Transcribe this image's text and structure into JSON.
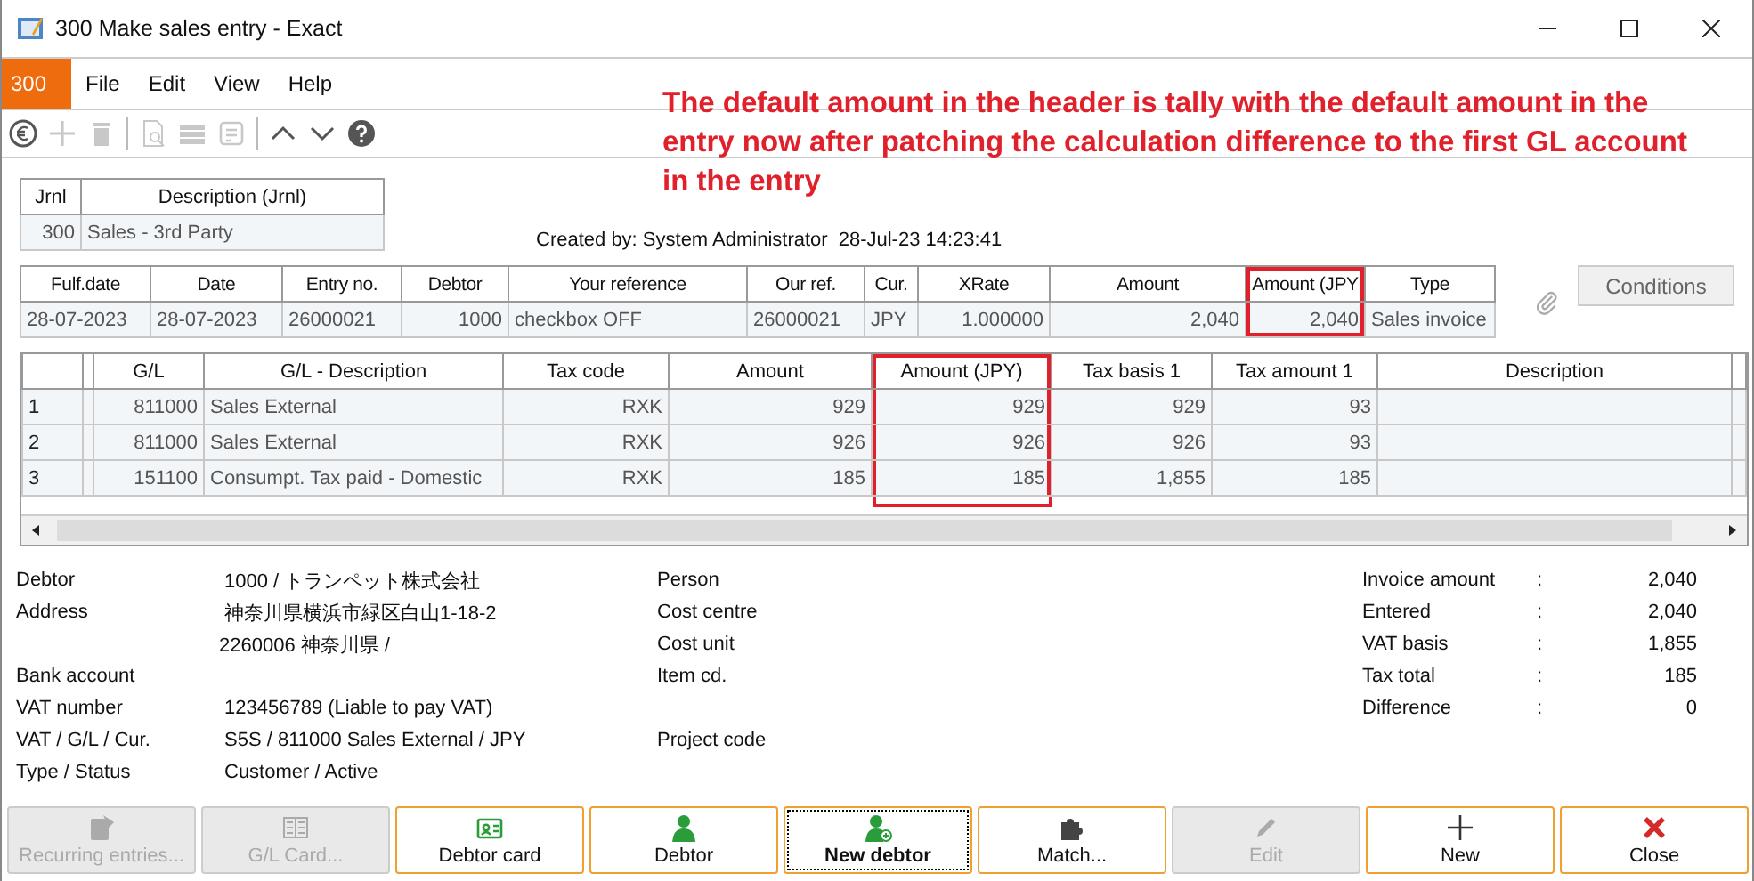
{
  "window": {
    "title": "300 Make sales entry - Exact"
  },
  "menu": {
    "badge": "300",
    "items": [
      "File",
      "Edit",
      "View",
      "Help"
    ]
  },
  "toolbar": [
    {
      "kind": "euro",
      "disabled": false
    },
    {
      "kind": "plus",
      "disabled": true
    },
    {
      "kind": "trash",
      "disabled": true
    },
    {
      "kind": "preview",
      "disabled": true
    },
    {
      "kind": "list",
      "disabled": true
    },
    {
      "kind": "note",
      "disabled": true
    },
    {
      "kind": "up",
      "disabled": false
    },
    {
      "kind": "down",
      "disabled": false
    },
    {
      "kind": "help",
      "disabled": false
    }
  ],
  "annotation": "The default amount in the header is tally with the default amount in the entry now after patching the calculation difference to the first GL account in the entry",
  "journal": {
    "columns": [
      "Jrnl",
      "Description (Jrnl)"
    ],
    "row": [
      "300",
      "Sales - 3rd Party"
    ]
  },
  "created_by": {
    "label": "Created by: System Administrator",
    "timestamp": "28-Jul-23 14:23:41"
  },
  "header": {
    "columns": [
      {
        "label": "Fulf.date",
        "highlighted": false
      },
      {
        "label": "Date",
        "highlighted": false
      },
      {
        "label": "Entry no.",
        "highlighted": false
      },
      {
        "label": "Debtor",
        "highlighted": false
      },
      {
        "label": "Your reference",
        "highlighted": false
      },
      {
        "label": "Our ref.",
        "highlighted": false
      },
      {
        "label": "Cur.",
        "highlighted": false
      },
      {
        "label": "XRate",
        "highlighted": false
      },
      {
        "label": "Amount",
        "highlighted": false
      },
      {
        "label": "Amount (JPY",
        "highlighted": true
      },
      {
        "label": "Type",
        "highlighted": false
      }
    ],
    "row": [
      "28-07-2023",
      "28-07-2023",
      "26000021",
      "1000",
      "checkbox OFF",
      "26000021",
      "JPY",
      "1.000000",
      "2,040",
      "2,040",
      "Sales invoice"
    ]
  },
  "conditions_button": {
    "label": "Conditions",
    "disabled": true
  },
  "lines": {
    "columns": [
      {
        "label": "G/L",
        "highlighted": false
      },
      {
        "label": "G/L - Description",
        "highlighted": false
      },
      {
        "label": "Tax code",
        "highlighted": false
      },
      {
        "label": "Amount",
        "highlighted": false
      },
      {
        "label": "Amount (JPY)",
        "highlighted": true
      },
      {
        "label": "Tax basis 1",
        "highlighted": false
      },
      {
        "label": "Tax amount 1",
        "highlighted": false
      },
      {
        "label": "Description",
        "highlighted": false
      }
    ],
    "rows": [
      {
        "number": "1",
        "cells": [
          "811000",
          "Sales External",
          "RXK",
          "929",
          "929",
          "929",
          "93"
        ]
      },
      {
        "number": "2",
        "cells": [
          "811000",
          "Sales External",
          "RXK",
          "926",
          "926",
          "926",
          "93"
        ]
      },
      {
        "number": "3",
        "cells": [
          "151100",
          "Consumpt. Tax paid - Domestic",
          "RXK",
          "185",
          "185",
          "1,855",
          "185"
        ]
      }
    ]
  },
  "details": [
    {
      "label": "Debtor",
      "values": [
        "1000 / トランペット株式会社"
      ],
      "middle": "Person"
    },
    {
      "label": "Address",
      "values": [
        "神奈川県横浜市緑区白山1-18-2",
        "2260006 神奈川県 /"
      ],
      "middle": "Cost centre"
    },
    {
      "label": "Bank account",
      "middle": "Item cd."
    },
    {
      "label": "VAT number",
      "values": [
        "123456789 (Liable to pay VAT)"
      ]
    },
    {
      "label": "VAT / G/L / Cur.",
      "values": [
        "S5S / 811000 Sales External / JPY"
      ],
      "middle": "Project code"
    },
    {
      "label": "Type / Status",
      "values": [
        "Customer / Active"
      ]
    }
  ],
  "extra_middle": "Cost unit",
  "totals": [
    {
      "label": "Invoice amount",
      "sep": ":",
      "value": "2,040"
    },
    {
      "label": "Entered",
      "sep": ":",
      "value": "2,040"
    },
    {
      "label": "VAT basis",
      "sep": ":",
      "value": "1,855"
    },
    {
      "label": "Tax total",
      "sep": ":",
      "value": "185"
    },
    {
      "label": "Difference",
      "sep": ":",
      "value": "0"
    }
  ],
  "buttons": [
    {
      "label": "Recurring entries...",
      "kind": "recurring",
      "disabled": true,
      "default": false
    },
    {
      "label": "G/L Card...",
      "kind": "card",
      "disabled": true,
      "default": false
    },
    {
      "label": "Debtor card",
      "kind": "idcard",
      "disabled": false,
      "default": false
    },
    {
      "label": "Debtor",
      "kind": "person",
      "disabled": false,
      "default": false
    },
    {
      "label": "New debtor",
      "kind": "person-add",
      "disabled": false,
      "default": true
    },
    {
      "label": "Match...",
      "kind": "puzzle",
      "disabled": false,
      "default": false
    },
    {
      "label": "Edit",
      "kind": "pencil",
      "disabled": true,
      "default": false
    },
    {
      "label": "New",
      "kind": "plus",
      "disabled": false,
      "default": false
    },
    {
      "label": "Close",
      "kind": "cross",
      "disabled": false,
      "default": false
    }
  ]
}
